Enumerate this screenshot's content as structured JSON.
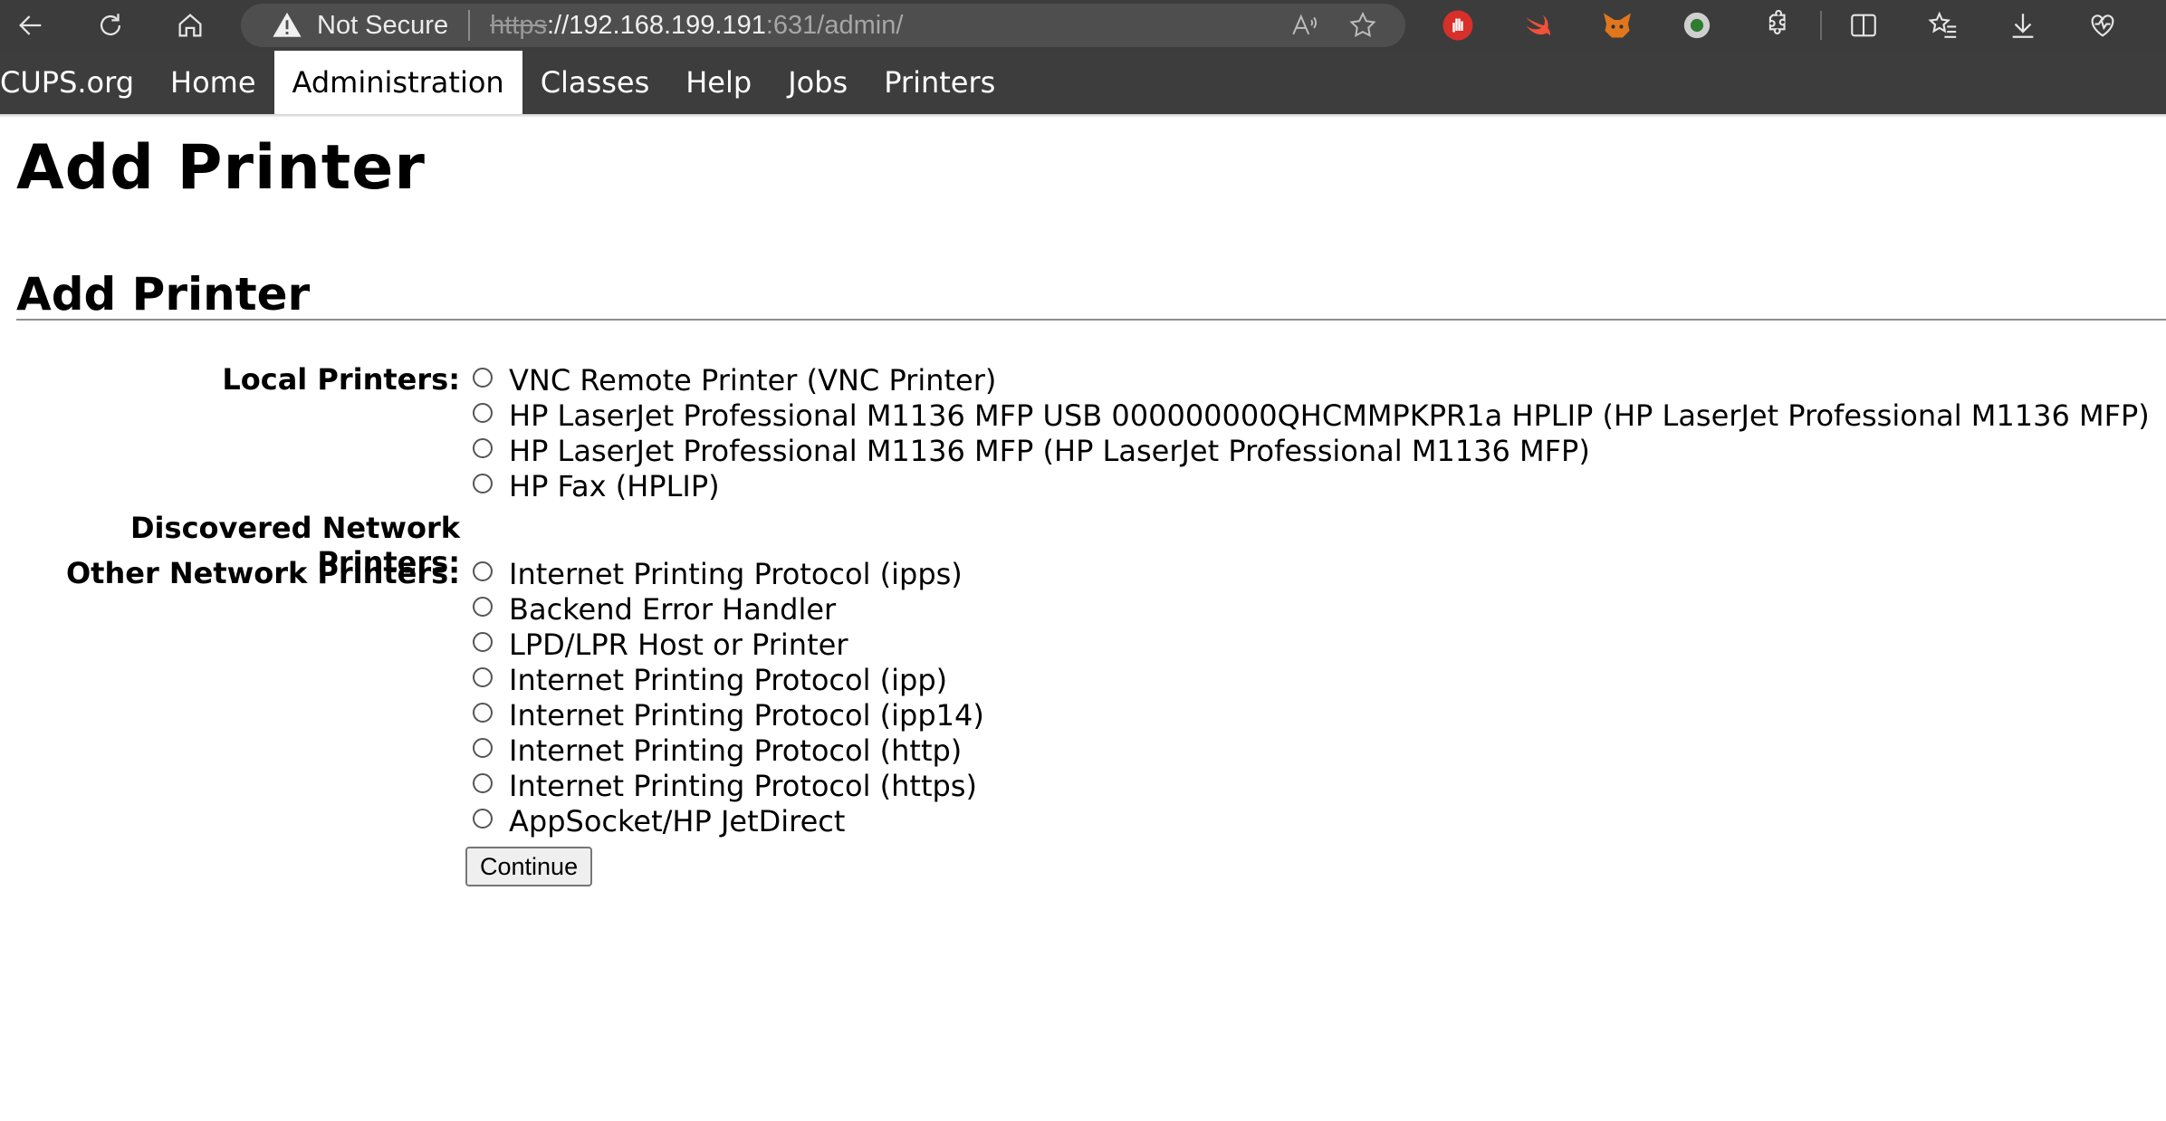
{
  "browser": {
    "security_label": "Not Secure",
    "url_scheme": "https",
    "url_host": "://192.168.199.191",
    "url_rest": ":631/admin/"
  },
  "nav": {
    "items": [
      {
        "label": "CUPS.org"
      },
      {
        "label": "Home"
      },
      {
        "label": "Administration",
        "active": true
      },
      {
        "label": "Classes"
      },
      {
        "label": "Help"
      },
      {
        "label": "Jobs"
      },
      {
        "label": "Printers"
      }
    ]
  },
  "page": {
    "title": "Add Printer",
    "section_title": "Add Printer"
  },
  "form": {
    "local_label": "Local Printers:",
    "local_printers": [
      "VNC Remote Printer (VNC Printer)",
      "HP LaserJet Professional M1136 MFP USB 000000000QHCMMPKPR1a HPLIP (HP LaserJet Professional M1136 MFP)",
      "HP LaserJet Professional M1136 MFP (HP LaserJet Professional M1136 MFP)",
      "HP Fax (HPLIP)"
    ],
    "discovered_label": "Discovered Network Printers:",
    "other_label": "Other Network Printers:",
    "other_printers": [
      "Internet Printing Protocol (ipps)",
      "Backend Error Handler",
      "LPD/LPR Host or Printer",
      "Internet Printing Protocol (ipp)",
      "Internet Printing Protocol (ipp14)",
      "Internet Printing Protocol (http)",
      "Internet Printing Protocol (https)",
      "AppSocket/HP JetDirect"
    ],
    "continue_label": "Continue"
  }
}
